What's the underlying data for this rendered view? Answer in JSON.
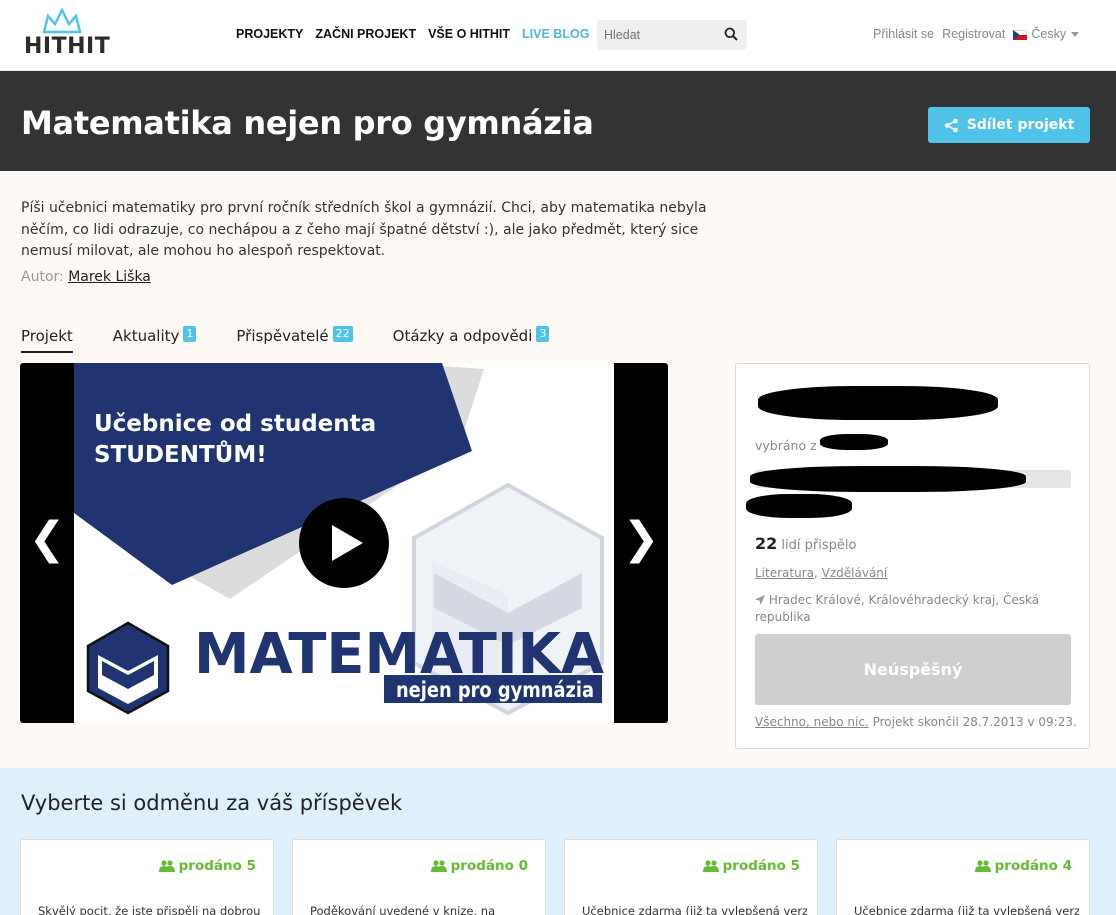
{
  "brand": {
    "logo_text": "HITHIT"
  },
  "nav": {
    "items": [
      "PROJEKTY",
      "ZAČNI PROJEKT",
      "VŠE O HITHIT",
      "LIVE BLOG"
    ]
  },
  "search": {
    "placeholder": "Hledat"
  },
  "user": {
    "login": "Přihlásit se",
    "register": "Registrovat",
    "language": "Česky"
  },
  "project": {
    "title": "Matematika nejen pro gymnázia",
    "share_label": "Sdílet projekt",
    "description": "Píši učebnici matematiky pro první ročník středních škol a gymnázií. Chci, aby matematika nebyla něčím, co lidi odrazuje, co nechápou a z čeho mají špatné dětství :), ale jako předmět, který sice nemusí milovat, ale mohou ho alespoň respektovat.",
    "author_label": "Autor:",
    "author_name": "Marek Liška"
  },
  "tabs": [
    {
      "label": "Projekt",
      "badge": ""
    },
    {
      "label": "Aktuality",
      "badge": "1"
    },
    {
      "label": "Přispěvatelé",
      "badge": "22"
    },
    {
      "label": "Otázky a odpovědi",
      "badge": "3"
    }
  ],
  "video": {
    "line1": "Učebnice od studenta",
    "line2": "STUDENTŮM!",
    "big": "MATEMATIKA",
    "sub": "nejen pro gymnázia",
    "prev": "❮",
    "next": "❯"
  },
  "stats": {
    "collected_label": "vybráno z",
    "contributors_count": "22",
    "contributors_label": "lidí přispělo",
    "category1": "Literatura",
    "category2": "Vzdělávání",
    "location": "Hradec Králové, Královéhradecký kraj, Česká republika",
    "status_button": "Neúspěšný",
    "all_or_nothing": "Všechno, nebo nic.",
    "ended_text": "Projekt skončil 28.7.2013 v 09:23."
  },
  "rewards": {
    "heading": "Vyberte si odměnu za váš příspěvek",
    "cards": [
      {
        "sold": "prodáno 5",
        "text": "Skvělý pocit, že jste přispěli na dobrou"
      },
      {
        "sold": "prodáno 0",
        "text": "Poděkování uvedené v knize, na"
      },
      {
        "sold": "prodáno 5",
        "text": "Učebnice zdarma (již ta vylepšená verze,"
      },
      {
        "sold": "prodáno 4",
        "text": "Učebnice zdarma (již ta vylepšená verze,"
      }
    ]
  },
  "colors": {
    "accent": "#4fc3e8",
    "header_bg": "#333333",
    "success_green": "#66bb33",
    "video_navy": "#1f3470"
  }
}
